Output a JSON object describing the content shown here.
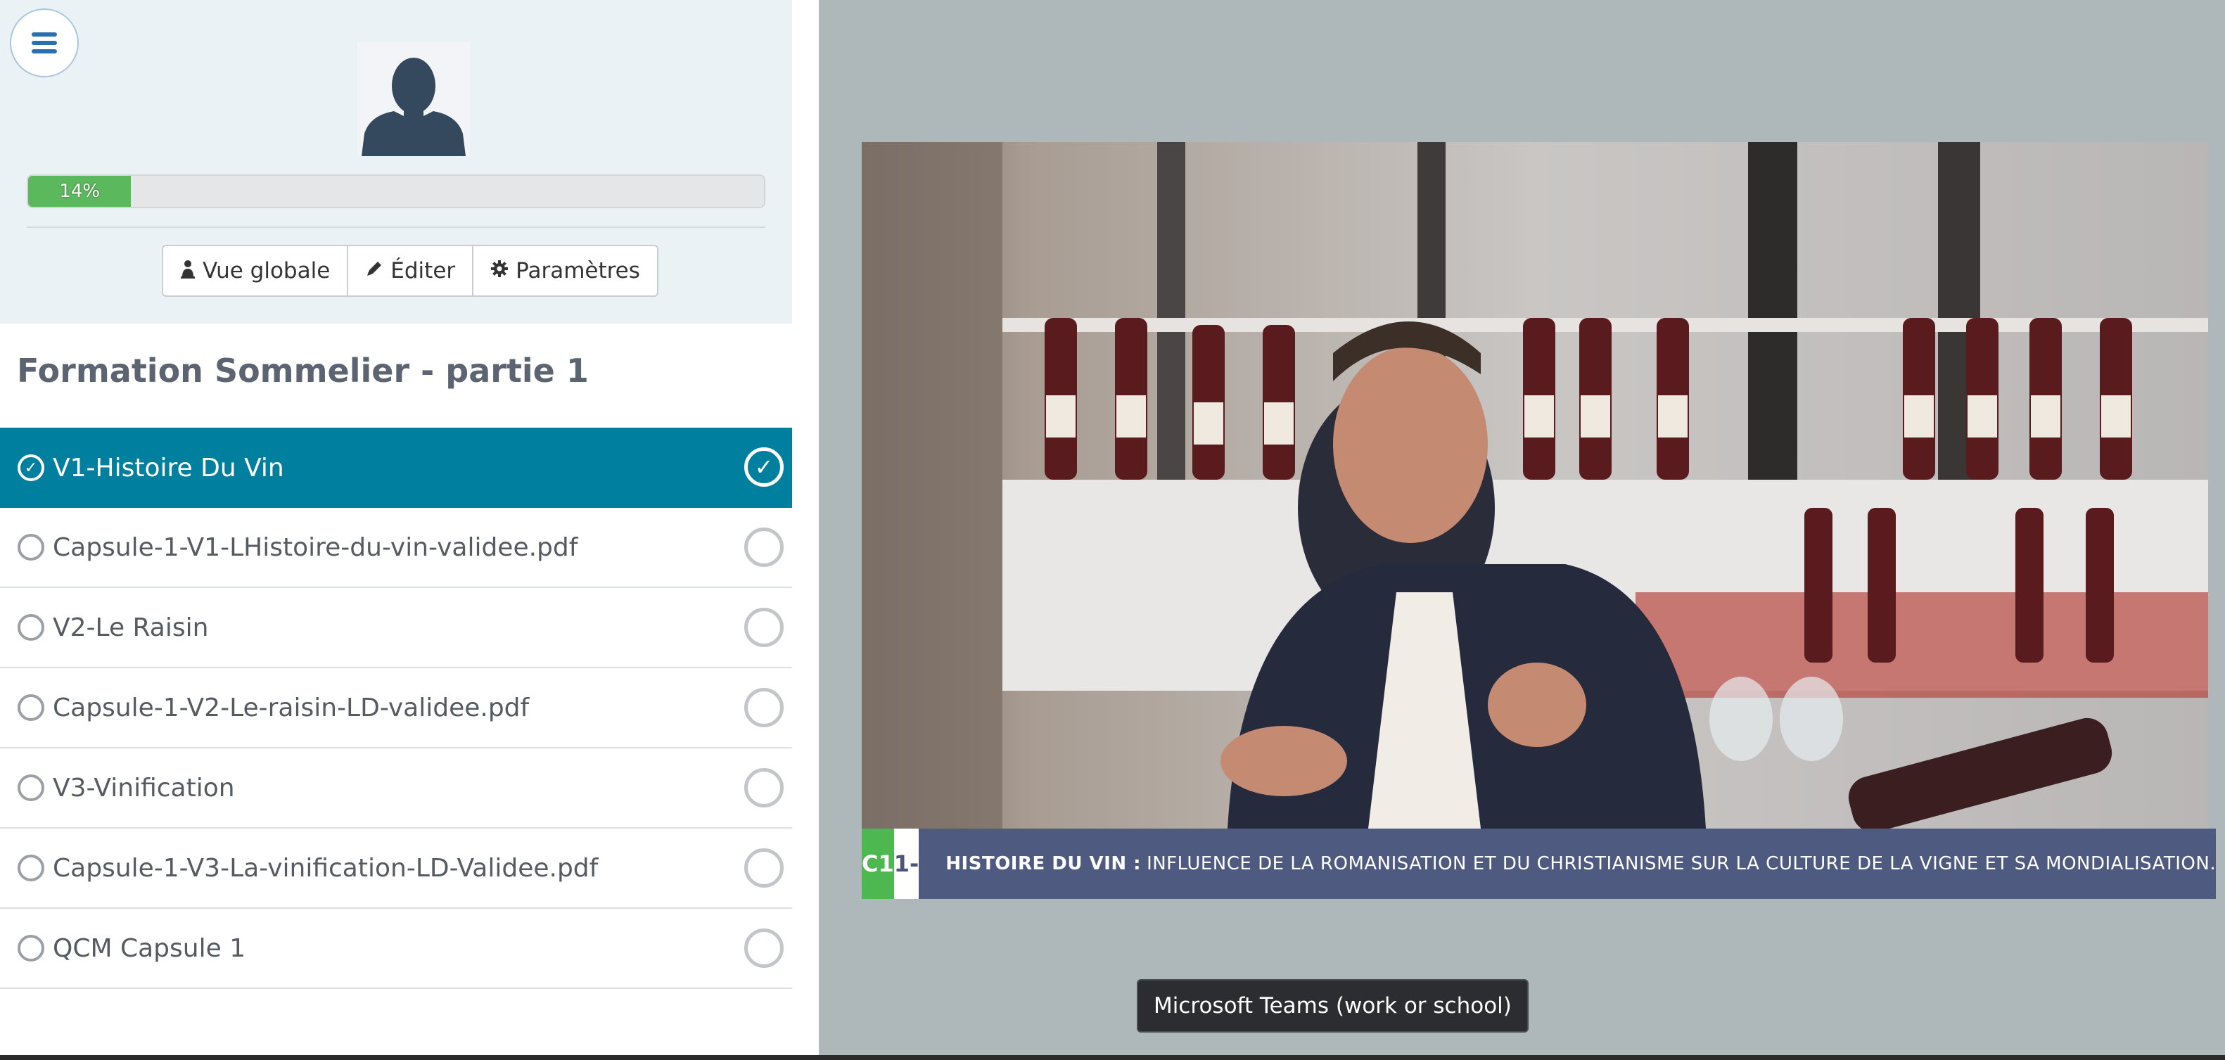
{
  "sidebar": {
    "progress": {
      "value": 14,
      "label": "14%",
      "color": "#5cb85c"
    },
    "buttons": [
      {
        "label": "Vue globale",
        "icon": "user-icon"
      },
      {
        "label": "Éditer",
        "icon": "pencil-icon"
      },
      {
        "label": "Paramètres",
        "icon": "gear-icon"
      }
    ],
    "course_title": "Formation Sommelier - partie 1",
    "lessons": [
      {
        "label": "V1-Histoire Du Vin",
        "active": true,
        "completed": true
      },
      {
        "label": "Capsule-1-V1-LHistoire-du-vin-validee.pdf",
        "active": false,
        "completed": false
      },
      {
        "label": "V2-Le Raisin",
        "active": false,
        "completed": false
      },
      {
        "label": "Capsule-1-V2-Le-raisin-LD-validee.pdf",
        "active": false,
        "completed": false
      },
      {
        "label": "V3-Vinification",
        "active": false,
        "completed": false
      },
      {
        "label": "Capsule-1-V3-La-vinification-LD-Validee.pdf",
        "active": false,
        "completed": false
      },
      {
        "label": "QCM Capsule 1",
        "active": false,
        "completed": false
      }
    ],
    "active_color": "#007f9e"
  },
  "video": {
    "caption": {
      "chapter": "C1",
      "number": "1-",
      "title": "HISTOIRE DU VIN :",
      "text": "INFLUENCE DE LA ROMANISATION ET DU CHRISTIANISME SUR LA CULTURE DE LA VIGNE ET SA MONDIALISATION."
    }
  },
  "tooltip": {
    "text": "Microsoft Teams (work or school)"
  }
}
